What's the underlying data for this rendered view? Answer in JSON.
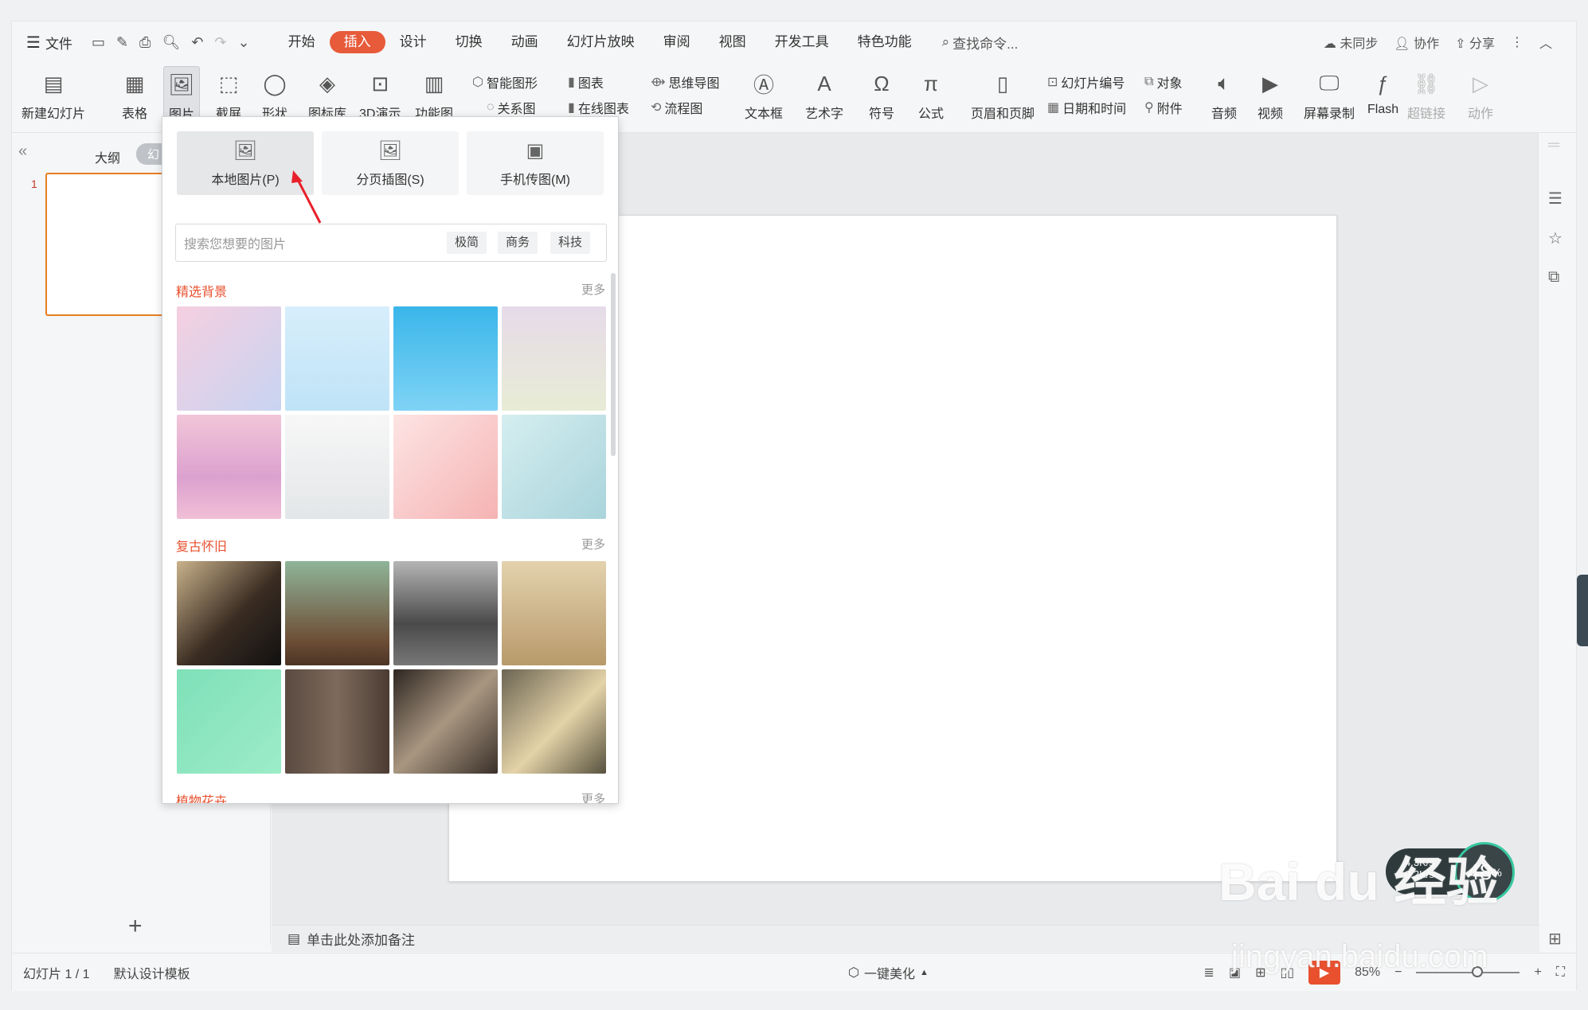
{
  "menubar": {
    "file": "文件",
    "tabs": [
      "开始",
      "插入",
      "设计",
      "切换",
      "动画",
      "幻灯片放映",
      "审阅",
      "视图",
      "开发工具",
      "特色功能"
    ],
    "active_tab": "插入",
    "command_search": "查找命令...",
    "sync": "未同步",
    "collab": "协作",
    "share": "分享"
  },
  "ribbon": {
    "new_slide": "新建幻灯片",
    "table": "表格",
    "picture": "图片",
    "screenshot": "截屏",
    "shape": "形状",
    "icon_lib": "图标库",
    "demo3d": "3D演示",
    "func_chart": "功能图",
    "smart_shape": "智能图形",
    "chart": "图表",
    "mindmap": "思维导图",
    "relation": "关系图",
    "online_chart": "在线图表",
    "flowchart": "流程图",
    "textbox": "文本框",
    "wordart": "艺术字",
    "symbol": "符号",
    "formula": "公式",
    "header_footer": "页眉和页脚",
    "slide_number": "幻灯片编号",
    "object": "对象",
    "datetime": "日期和时间",
    "attachment": "附件",
    "audio": "音频",
    "video": "视频",
    "screen_record": "屏幕录制",
    "flash": "Flash",
    "hyperlink": "超链接",
    "action": "动作"
  },
  "leftpanel": {
    "outline": "大纲",
    "slides_tab": "幻",
    "slide_number": "1",
    "add": "+"
  },
  "dropdown": {
    "options": [
      "本地图片(P)",
      "分页插图(S)",
      "手机传图(M)"
    ],
    "search_placeholder": "搜索您想要的图片",
    "chips": [
      "极简",
      "商务",
      "科技"
    ],
    "sections": [
      {
        "title": "精选背景",
        "more": "更多"
      },
      {
        "title": "复古怀旧",
        "more": "更多"
      },
      {
        "title": "植物花卉",
        "more": "更多"
      }
    ]
  },
  "notes": "单击此处添加备注",
  "status": {
    "slide_count": "幻灯片 1 / 1",
    "template": "默认设计模板",
    "beautify": "一键美化",
    "zoom": "85%"
  },
  "netspeed": {
    "up": "4.3K/s",
    "down": "0.2K/s",
    "percent": "48"
  },
  "watermark": {
    "main": "Bai du 经验",
    "sub": "jingyan.baidu.com"
  },
  "colors": {
    "accent": "#e8502e",
    "thumb_border": "#e67e22"
  }
}
